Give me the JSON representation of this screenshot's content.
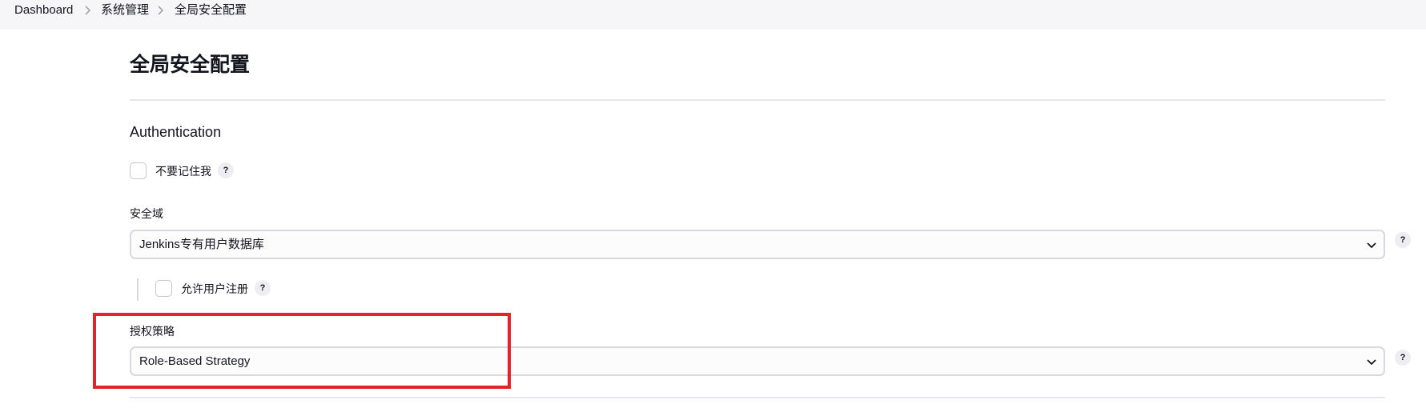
{
  "breadcrumb": {
    "items": [
      "Dashboard",
      "系统管理",
      "全局安全配置"
    ]
  },
  "page": {
    "title": "全局安全配置"
  },
  "authentication": {
    "section_title": "Authentication",
    "remember_me": {
      "label": "不要记住我",
      "checked": false,
      "help": "?"
    },
    "security_realm": {
      "label": "安全域",
      "selected": "Jenkins专有用户数据库",
      "help": "?",
      "allow_signup": {
        "label": "允许用户注册",
        "checked": false,
        "help": "?"
      }
    },
    "authorization": {
      "label": "授权策略",
      "selected": "Role-Based Strategy",
      "help": "?"
    }
  },
  "icons": {
    "breadcrumb_separator": "chevron-right-icon",
    "select_arrow": "chevron-down-icon",
    "help": "help-icon"
  },
  "colors": {
    "highlight_border": "#e3222c",
    "breadcrumb_bg": "#f6f6f8"
  }
}
